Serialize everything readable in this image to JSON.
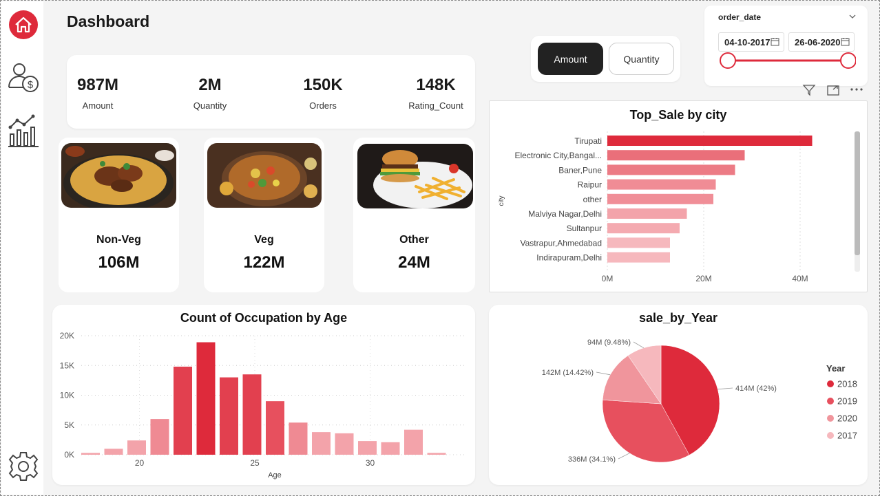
{
  "header": {
    "title": "Dashboard"
  },
  "sidebar": {
    "items": [
      {
        "icon": "home-icon"
      },
      {
        "icon": "customer-money-icon"
      },
      {
        "icon": "line-bar-chart-icon"
      },
      {
        "icon": "gear-icon"
      }
    ]
  },
  "kpis": [
    {
      "value": "987M",
      "label": "Amount"
    },
    {
      "value": "2M",
      "label": "Quantity"
    },
    {
      "value": "150K",
      "label": "Orders"
    },
    {
      "value": "148K",
      "label": "Rating_Count"
    }
  ],
  "food_cards": [
    {
      "name": "Non-Veg",
      "value": "106M"
    },
    {
      "name": "Veg",
      "value": "122M"
    },
    {
      "name": "Other",
      "value": "24M"
    }
  ],
  "toggle": {
    "amount_label": "Amount",
    "quantity_label": "Quantity",
    "selected": "Amount"
  },
  "date_filter": {
    "label": "order_date",
    "start": "04-10-2017",
    "end": "26-06-2020"
  },
  "colors": {
    "accent": "#de2a3b",
    "mid": "#e7505e",
    "light": "#f39aa2",
    "lighter": "#f6b8bd"
  },
  "chart_data": [
    {
      "type": "bar",
      "orientation": "horizontal",
      "title": "Top_Sale by city",
      "ylabel": "city",
      "xlabel": "",
      "categories": [
        "Tirupati",
        "Electronic City,Bangal...",
        "Baner,Pune",
        "Raipur",
        "other",
        "Malviya Nagar,Delhi",
        "Sultanpur",
        "Vastrapur,Ahmedabad",
        "Indirapuram,Delhi"
      ],
      "values": [
        42.5,
        28.5,
        26.5,
        22.5,
        22.0,
        16.5,
        15.0,
        13.0,
        13.0
      ],
      "unit": "M",
      "xticks": [
        "0M",
        "20M",
        "40M"
      ],
      "xlim": [
        0,
        52
      ]
    },
    {
      "type": "bar",
      "title": "Count of Occupation by Age",
      "xlabel": "Age",
      "ylabel": "",
      "x": [
        18,
        19,
        20,
        21,
        22,
        23,
        24,
        25,
        26,
        27,
        28,
        29,
        30,
        31,
        32,
        33
      ],
      "values": [
        300,
        1000,
        2400,
        6000,
        14800,
        18900,
        13000,
        13500,
        9000,
        5400,
        3800,
        3600,
        2300,
        2100,
        4200,
        300
      ],
      "xticks": [
        "20",
        "25",
        "30"
      ],
      "yticks": [
        "0K",
        "5K",
        "10K",
        "15K",
        "20K"
      ],
      "ylim": [
        0,
        20000
      ]
    },
    {
      "type": "pie",
      "title": "sale_by_Year",
      "legend_title": "Year",
      "slices": [
        {
          "label": "2018",
          "value": 414,
          "text": "414M (42%)",
          "color": "#de2a3b"
        },
        {
          "label": "2019",
          "value": 336,
          "text": "336M (34.1%)",
          "color": "#e7505e"
        },
        {
          "label": "2020",
          "value": 142,
          "text": "142M (14.42%)",
          "color": "#f0959c"
        },
        {
          "label": "2017",
          "value": 94,
          "text": "94M (9.48%)",
          "color": "#f6b8bd"
        }
      ],
      "legend_placement": "right"
    }
  ]
}
